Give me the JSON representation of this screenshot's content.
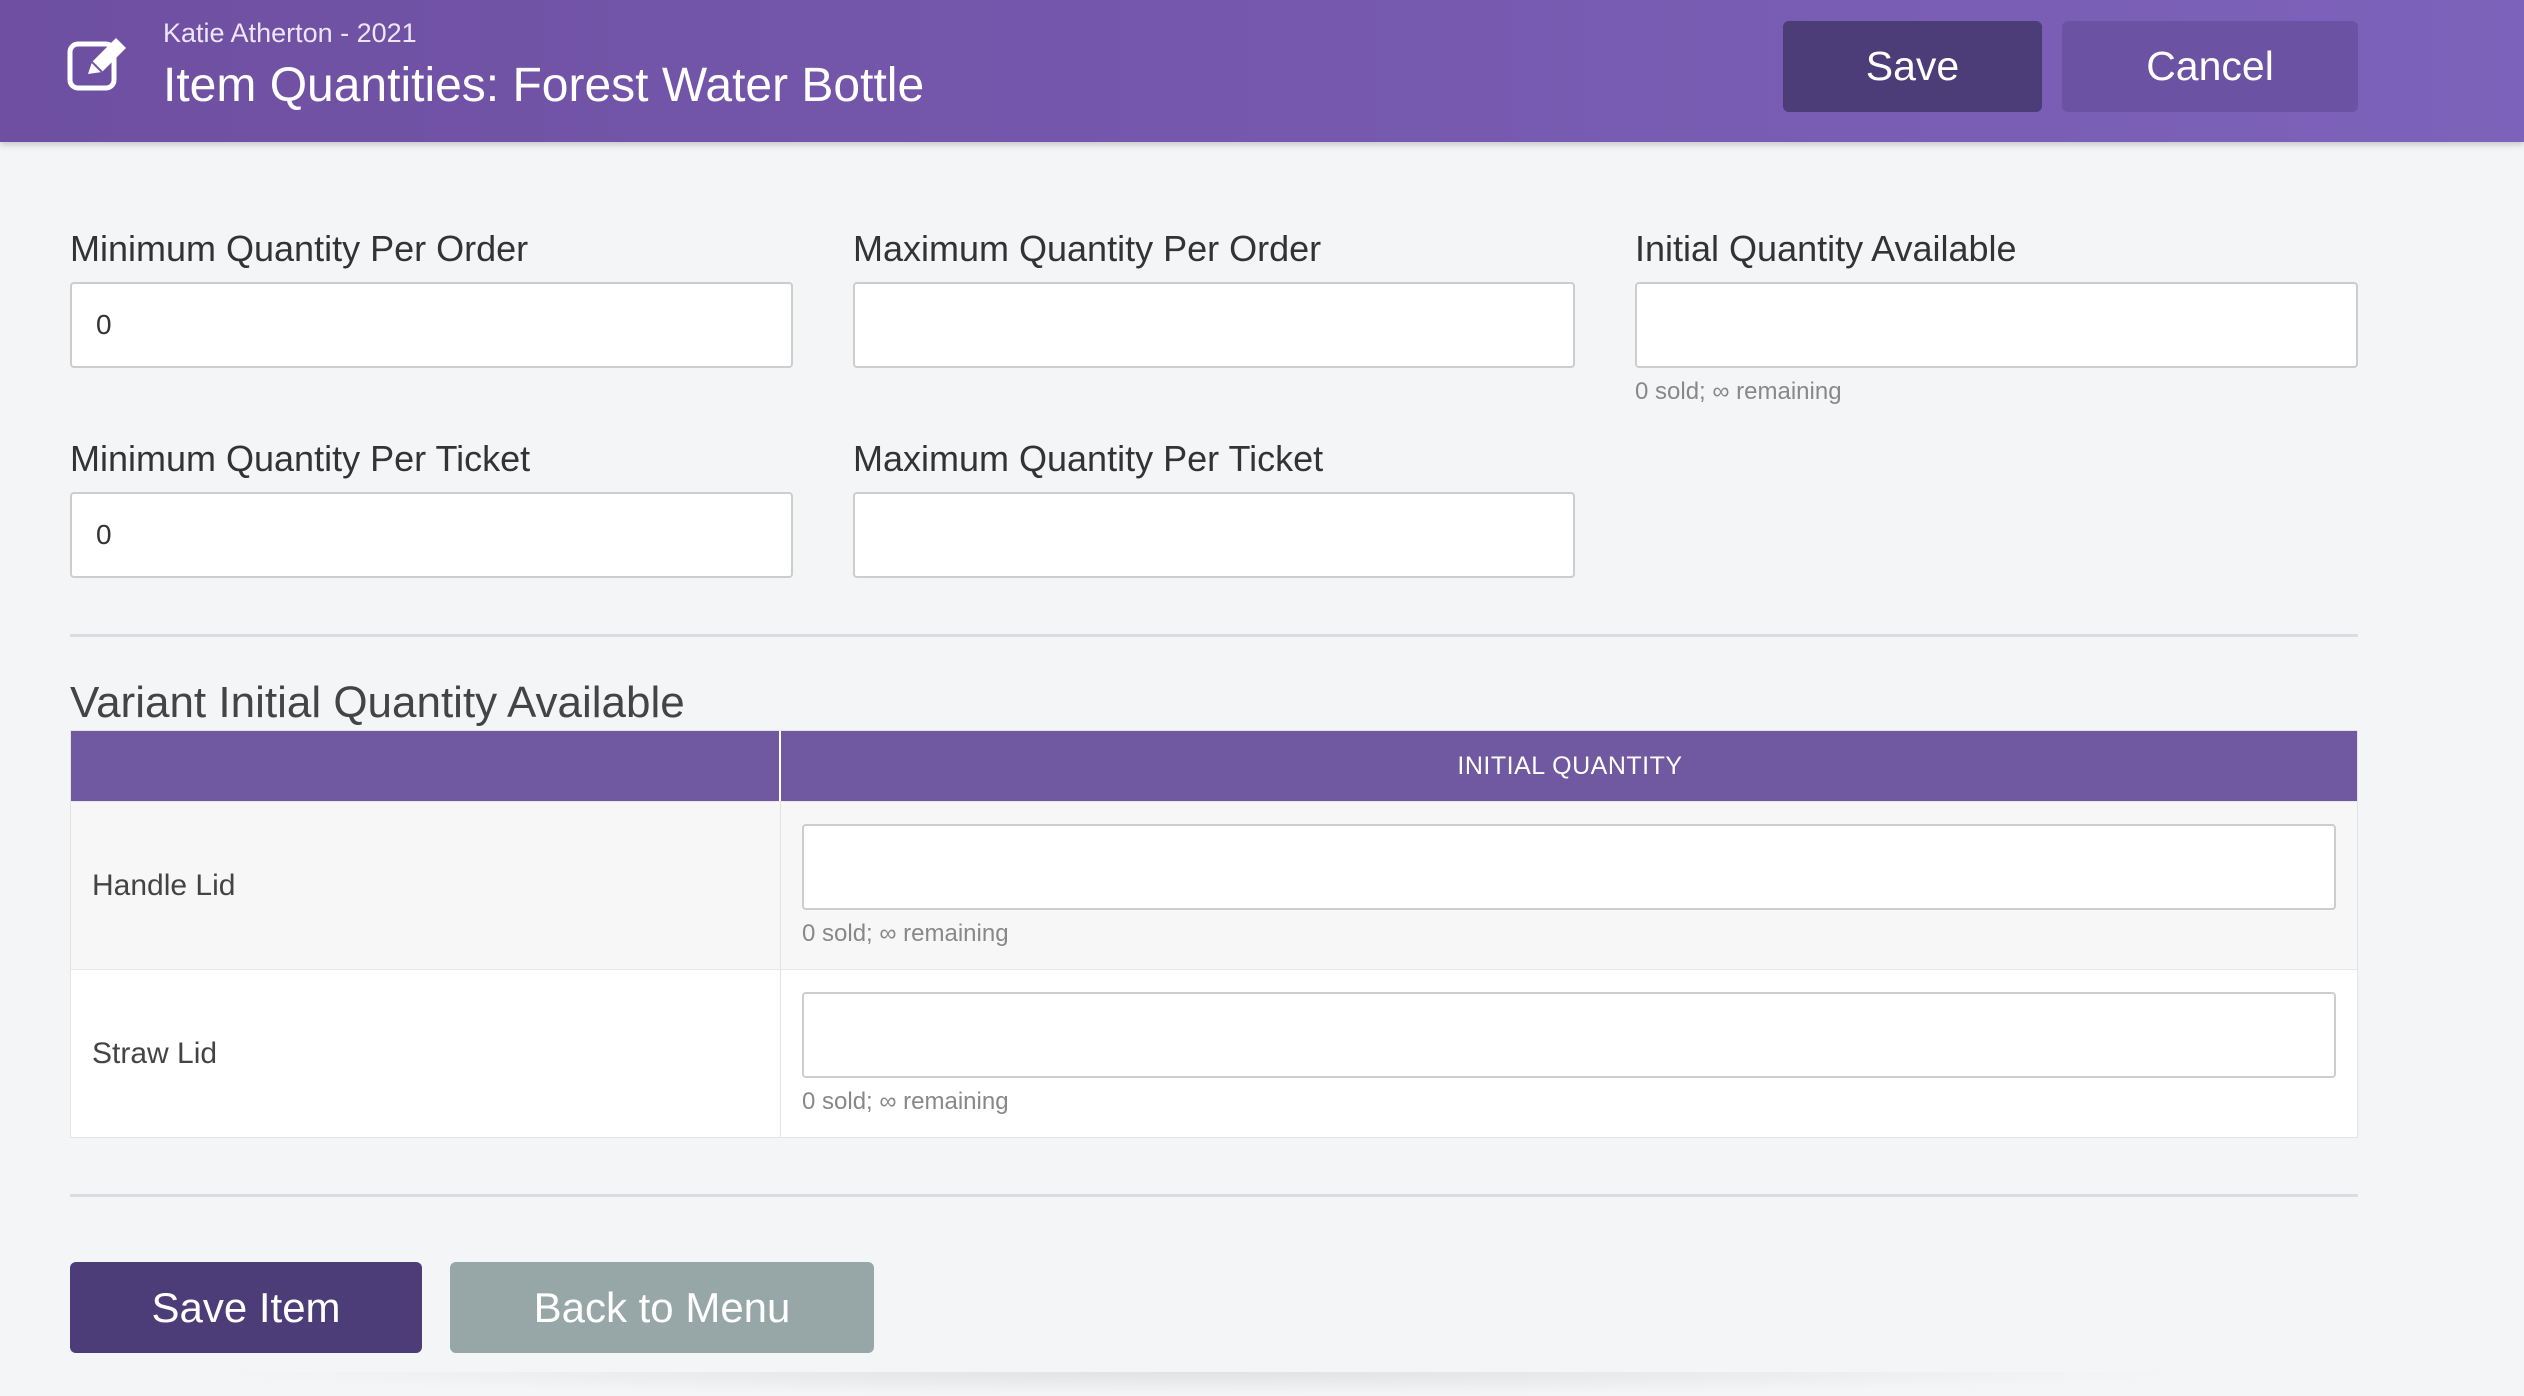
{
  "header": {
    "subtitle": "Katie Atherton - 2021",
    "title": "Item Quantities: Forest Water Bottle",
    "save_label": "Save",
    "cancel_label": "Cancel",
    "icon": "edit-icon"
  },
  "fields": {
    "min_order": {
      "label": "Minimum Quantity Per Order",
      "value": "0"
    },
    "max_order": {
      "label": "Maximum Quantity Per Order",
      "value": ""
    },
    "initial_qty": {
      "label": "Initial Quantity Available",
      "value": "",
      "hint": "0 sold; ∞ remaining"
    },
    "min_ticket": {
      "label": "Minimum Quantity Per Ticket",
      "value": "0"
    },
    "max_ticket": {
      "label": "Maximum Quantity Per Ticket",
      "value": ""
    }
  },
  "variants": {
    "title": "Variant Initial Quantity Available",
    "column_header": "INITIAL QUANTITY",
    "rows": [
      {
        "name": "Handle Lid",
        "value": "",
        "hint": "0 sold; ∞ remaining"
      },
      {
        "name": "Straw Lid",
        "value": "",
        "hint": "0 sold; ∞ remaining"
      }
    ]
  },
  "footer": {
    "save_item_label": "Save Item",
    "back_label": "Back to Menu"
  },
  "colors": {
    "header_purple": "#7059a1",
    "dark_purple": "#4c3c77",
    "gray_button": "#97a6a7"
  }
}
